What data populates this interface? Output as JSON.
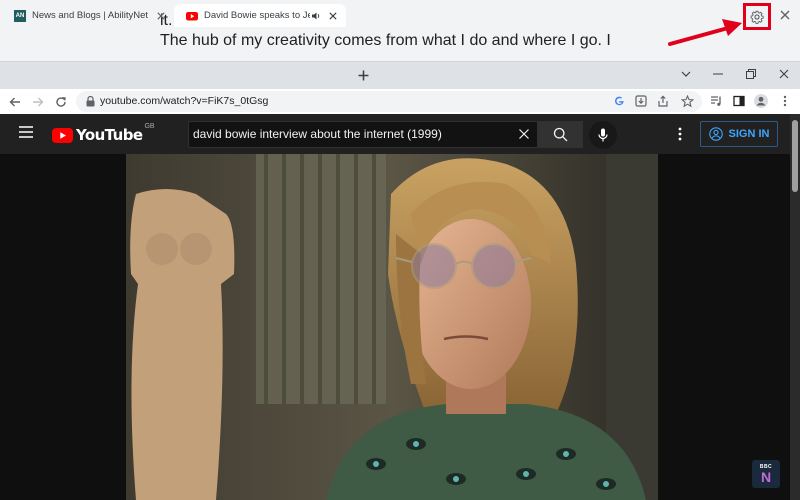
{
  "captions": {
    "lines": [
      "it.",
      "The hub of my creativity comes from what I do and where I go. I"
    ],
    "settings_icon": "gear-icon",
    "close_icon": "close-icon",
    "highlight_color": "#e0001b"
  },
  "tabs": [
    {
      "title": "News and Blogs | AbilityNet",
      "favicon_text": "AN",
      "active": false
    },
    {
      "title": "David Bowie speaks to Jeremy P",
      "favicon": "youtube-icon",
      "audio": true,
      "active": true
    }
  ],
  "address_bar": {
    "url": "youtube.com/watch?v=FiK7s_0tGsg"
  },
  "youtube": {
    "logo_text": "YouTube",
    "region": "GB",
    "search_value": "david bowie interview about the internet (1999)",
    "signin_label": "SIGN IN",
    "brand_color": "#ff0000",
    "accent_color": "#3ea6ff"
  },
  "video": {
    "watermark": "BBC",
    "watermark_letter": "N"
  }
}
